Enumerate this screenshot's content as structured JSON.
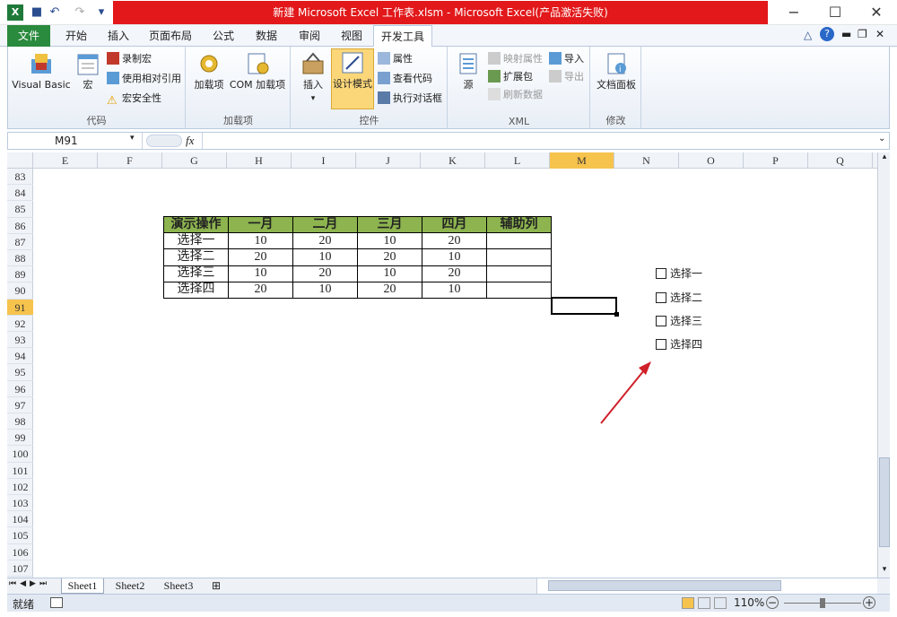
{
  "window": {
    "title": "新建 Microsoft Excel 工作表.xlsm  -  Microsoft Excel(产品激活失败)",
    "min": "−",
    "max": "☐",
    "close": "✕"
  },
  "tabs": [
    "文件",
    "开始",
    "插入",
    "页面布局",
    "公式",
    "数据",
    "审阅",
    "视图",
    "开发工具"
  ],
  "ribbon": {
    "groups": {
      "code": {
        "label": "代码",
        "visual_basic": "Visual Basic",
        "macros": "宏",
        "record_macro": "录制宏",
        "relative_ref": "使用相对引用",
        "macro_security": "宏安全性"
      },
      "addins": {
        "label": "加载项",
        "addins": "加载项",
        "com_addins": "COM 加载项"
      },
      "controls": {
        "label": "控件",
        "insert": "插入",
        "design_mode": "设计模式",
        "properties": "属性",
        "view_code": "查看代码",
        "run_dialog": "执行对话框"
      },
      "xml": {
        "label": "XML",
        "source": "源",
        "map_props": "映射属性",
        "expansion": "扩展包",
        "refresh": "刷新数据",
        "import": "导入",
        "export": "导出"
      },
      "modify": {
        "label": "修改",
        "doc_panel": "文档面板"
      }
    }
  },
  "formula": {
    "name_box": "M91",
    "fx": "fx",
    "value": ""
  },
  "columns": [
    "E",
    "F",
    "G",
    "H",
    "I",
    "J",
    "K",
    "L",
    "M",
    "N",
    "O",
    "P",
    "Q"
  ],
  "rows": [
    "83",
    "84",
    "85",
    "86",
    "87",
    "88",
    "89",
    "90",
    "91",
    "92",
    "93",
    "94",
    "95",
    "96",
    "97",
    "98",
    "99",
    "100",
    "101",
    "102",
    "103",
    "104",
    "105",
    "106",
    "107"
  ],
  "table": {
    "headers": [
      "演示操作",
      "一月",
      "二月",
      "三月",
      "四月",
      "辅助列"
    ],
    "rows": [
      [
        "选择一",
        "10",
        "20",
        "10",
        "20",
        ""
      ],
      [
        "选择二",
        "20",
        "10",
        "20",
        "10",
        ""
      ],
      [
        "选择三",
        "10",
        "20",
        "10",
        "20",
        ""
      ],
      [
        "选择四",
        "20",
        "10",
        "20",
        "10",
        ""
      ]
    ]
  },
  "checkboxes": [
    "选择一",
    "选择二",
    "选择三",
    "选择四"
  ],
  "sheets": [
    "Sheet1",
    "Sheet2",
    "Sheet3"
  ],
  "status": {
    "ready": "就绪",
    "zoom": "110%"
  },
  "colors": {
    "accent_green": "#2a8a3d",
    "title_red": "#e2181a",
    "header_green": "#8db44f",
    "select_orange": "#f6c34d",
    "arrow_red": "#d0202a"
  }
}
